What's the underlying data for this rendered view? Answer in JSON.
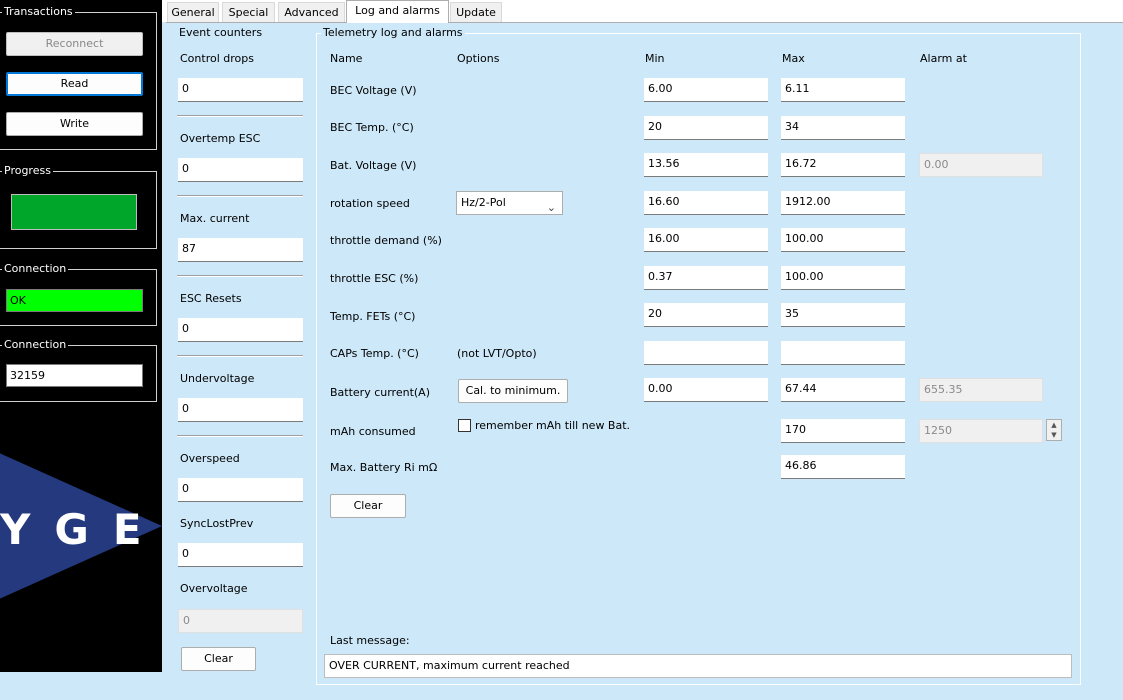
{
  "sidebar": {
    "transactions": {
      "title": "Transactions",
      "reconnect": "Reconnect",
      "read": "Read",
      "write": "Write"
    },
    "progress": {
      "title": "Progress",
      "value": 1.0,
      "color": "#00a62a"
    },
    "connection_status": {
      "title": "Connection",
      "value": "OK",
      "color": "#00ff00"
    },
    "connection_port": {
      "title": "Connection",
      "value": "32159"
    },
    "logo_text": "YGE",
    "logo_color": "#24397e"
  },
  "tabs": [
    {
      "label": "General"
    },
    {
      "label": "Special"
    },
    {
      "label": "Advanced"
    },
    {
      "label": "Log and alarms"
    },
    {
      "label": "Update"
    }
  ],
  "events": {
    "title": "Event counters",
    "control_drops": {
      "label": "Control drops",
      "value": "0"
    },
    "overtemp_esc": {
      "label": "Overtemp ESC",
      "value": "0"
    },
    "max_current": {
      "label": "Max. current",
      "value": "87"
    },
    "esc_resets": {
      "label": "ESC Resets",
      "value": "0"
    },
    "undervoltage": {
      "label": "Undervoltage",
      "value": "0"
    },
    "overspeed": {
      "label": "Overspeed",
      "value": "0"
    },
    "synclostprev": {
      "label": "SyncLostPrev",
      "value": "0"
    },
    "overvoltage": {
      "label": "Overvoltage",
      "value": "0"
    },
    "clear": "Clear"
  },
  "telemetry": {
    "title": "Telemetry log and alarms",
    "headers": {
      "name": "Name",
      "options": "Options",
      "min": "Min",
      "max": "Max",
      "alarm": "Alarm at"
    },
    "rows": [
      {
        "name": "BEC Voltage (V)",
        "min": "6.00",
        "max": "6.11"
      },
      {
        "name": "BEC Temp. (°C)",
        "min": "20",
        "max": "34"
      },
      {
        "name": "Bat. Voltage (V)",
        "min": "13.56",
        "max": "16.72",
        "alarm": "0.00"
      },
      {
        "name": "rotation speed",
        "option": "Hz/2-Pol",
        "min": "16.60",
        "max": "1912.00"
      },
      {
        "name": "throttle demand (%)",
        "min": "16.00",
        "max": "100.00"
      },
      {
        "name": "throttle ESC (%)",
        "min": "0.37",
        "max": "100.00"
      },
      {
        "name": "Temp. FETs (°C)",
        "min": "20",
        "max": "35"
      },
      {
        "name": "CAPs Temp. (°C)",
        "option": "(not LVT/Opto)",
        "min": "",
        "max": ""
      },
      {
        "name": "Battery current(A)",
        "option": "Cal. to minimum.",
        "min": "0.00",
        "max": "67.44",
        "alarm": "655.35"
      },
      {
        "name": "mAh consumed",
        "option": "remember mAh till new Bat.",
        "max": "170",
        "alarm": "1250"
      },
      {
        "name": "Max. Battery Ri mΩ",
        "max": "46.86"
      }
    ],
    "clear": "Clear",
    "last_message_label": "Last message:",
    "last_message": "OVER CURRENT, maximum current reached"
  },
  "icons": {
    "dropdown": "chevron-down-icon",
    "spin_up": "arrow-up-icon",
    "spin_down": "arrow-down-icon"
  }
}
